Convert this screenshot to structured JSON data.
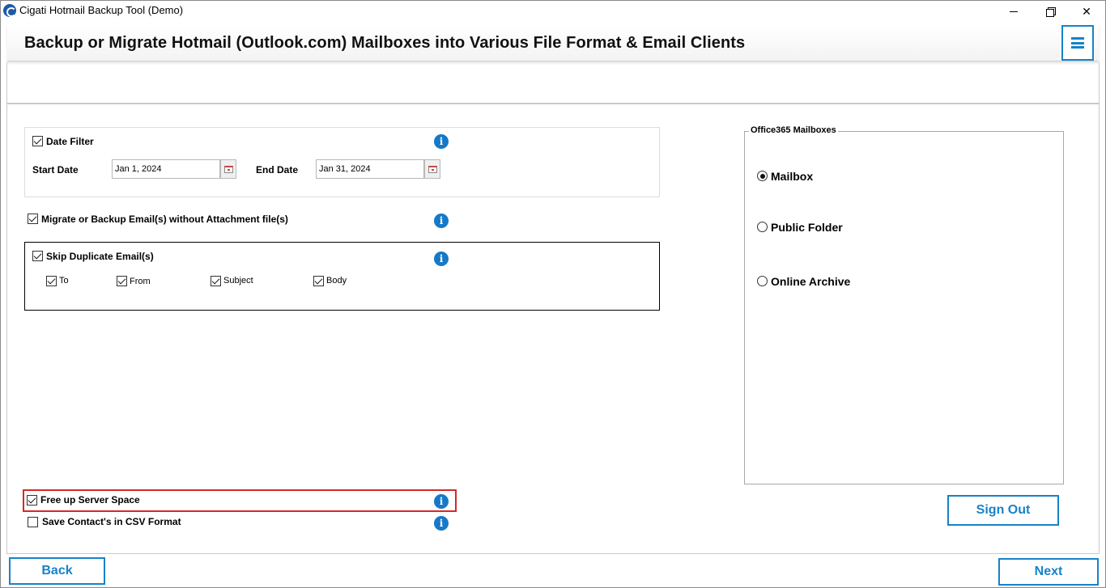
{
  "window": {
    "title": "Cigati Hotmail Backup Tool (Demo)",
    "minimize_glyph": "",
    "close_glyph": "✕"
  },
  "header": {
    "title": "Backup or Migrate Hotmail (Outlook.com) Mailboxes into Various File Format & Email Clients"
  },
  "filters": {
    "date_filter": {
      "label": "Date Filter",
      "checked": true
    },
    "start_date": {
      "label": "Start Date",
      "value": "Jan 1, 2024"
    },
    "end_date": {
      "label": "End Date",
      "value": "Jan 31, 2024"
    },
    "no_attachment": {
      "label": "Migrate or Backup Email(s) without Attachment file(s)",
      "checked": true
    },
    "skip_duplicate": {
      "label": "Skip Duplicate Email(s)",
      "checked": true,
      "options": [
        {
          "label": "To",
          "checked": true
        },
        {
          "label": "From",
          "checked": true
        },
        {
          "label": "Subject",
          "checked": true
        },
        {
          "label": "Body",
          "checked": true
        }
      ]
    },
    "free_up": {
      "label": "Free up Server Space",
      "checked": true
    },
    "save_contacts": {
      "label": "Save Contact's in CSV Format",
      "checked": false
    }
  },
  "info_glyph": "i",
  "office365": {
    "legend": "Office365 Mailboxes",
    "options": [
      {
        "label": "Mailbox",
        "selected": true
      },
      {
        "label": "Public Folder",
        "selected": false
      },
      {
        "label": "Online Archive",
        "selected": false
      }
    ]
  },
  "buttons": {
    "sign_out": "Sign Out",
    "back": "Back",
    "next": "Next"
  },
  "colors": {
    "accent": "#1683c8",
    "highlight": "#d62828",
    "info": "#1679c7"
  }
}
